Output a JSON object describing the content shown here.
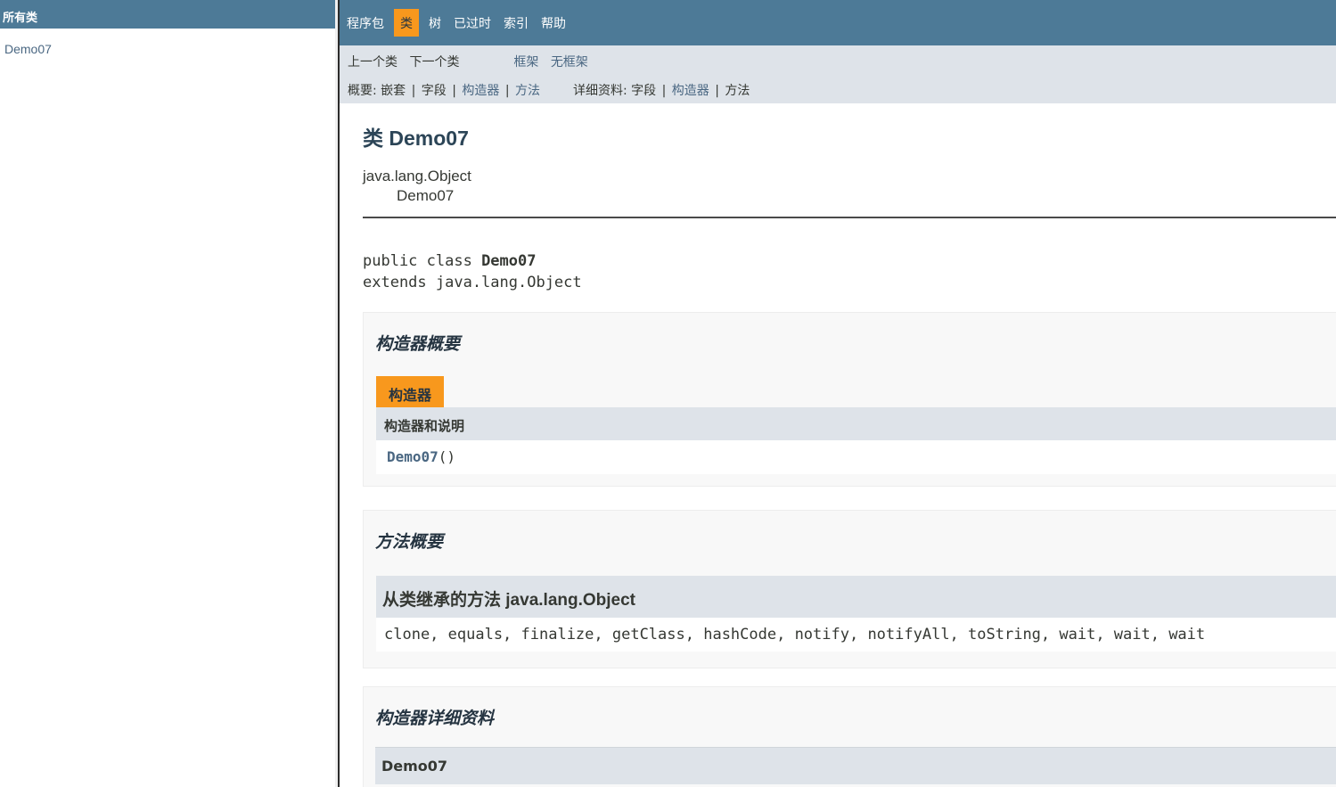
{
  "left": {
    "header": "所有类",
    "classes": [
      "Demo07"
    ]
  },
  "topnav": {
    "items": [
      "程序包",
      "类",
      "树",
      "已过时",
      "索引",
      "帮助"
    ],
    "active_index": 1
  },
  "subnav": {
    "prev_class": "上一个类",
    "next_class": "下一个类",
    "frames": "框架",
    "no_frames": "无框架",
    "summary_label": "概要:",
    "summary_nested": "嵌套",
    "summary_field": "字段",
    "summary_constructor": "构造器",
    "summary_method": "方法",
    "detail_label": "详细资料:",
    "detail_field": "字段",
    "detail_constructor": "构造器",
    "detail_method": "方法",
    "separator": "|"
  },
  "main": {
    "class_title": "类 Demo07",
    "inherit_parent": "java.lang.Object",
    "inherit_child": "Demo07",
    "signature_line1_prefix": "public class ",
    "signature_line1_name": "Demo07",
    "signature_line2": "extends java.lang.Object",
    "ctor_summary_title": "构造器概要",
    "ctor_tab": "构造器",
    "ctor_table_header": "构造器和说明",
    "ctor_name": "Demo07",
    "ctor_params": "()",
    "method_summary_title": "方法概要",
    "inherited_title": "从类继承的方法 java.lang.Object",
    "inherited_methods": "clone, equals, finalize, getClass, hashCode, notify, notifyAll, toString, wait, wait, wait",
    "ctor_detail_title": "构造器详细资料",
    "ctor_detail_name": "Demo07"
  },
  "colors": {
    "nav_bg": "#4d7a97",
    "active_tab": "#f8981d",
    "subnav_bg": "#dee3e9",
    "link": "#4a6782"
  }
}
